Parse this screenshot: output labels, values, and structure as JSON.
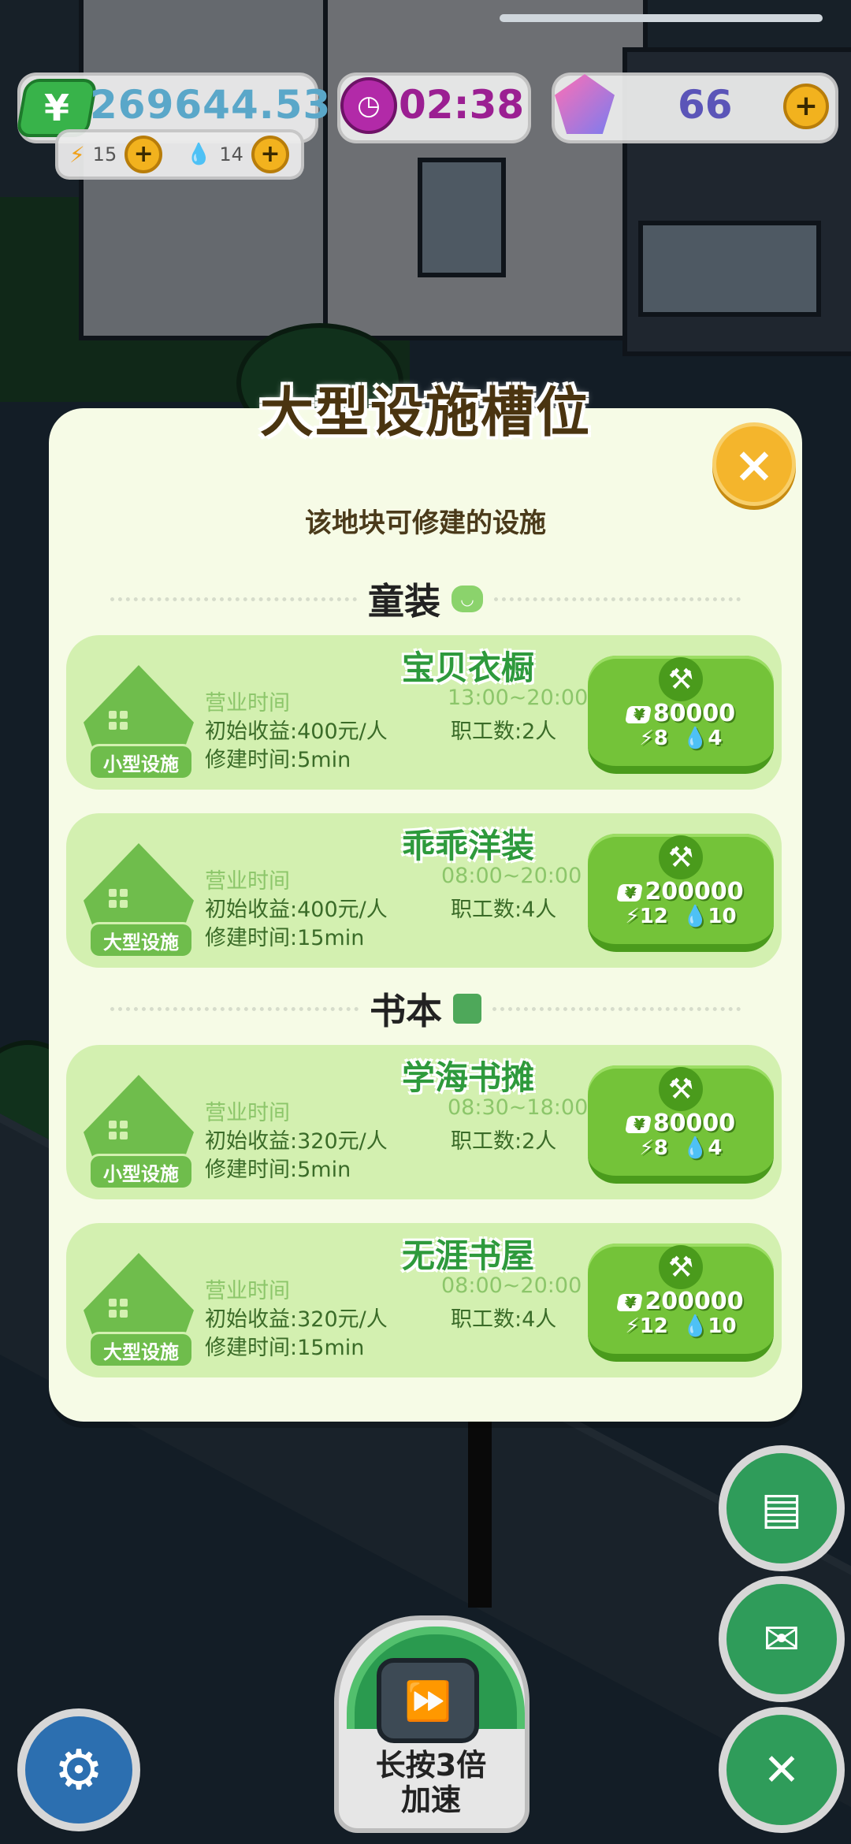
{
  "hud": {
    "currency_symbol": "¥",
    "money": "269644.53",
    "energy": "15",
    "water": "14",
    "timer": "02:38",
    "gems": "66",
    "plus": "+"
  },
  "modal": {
    "title": "大型设施槽位",
    "subtitle": "该地块可修建的设施",
    "close": "×",
    "sections": [
      {
        "label": "童装",
        "items": [
          {
            "name": "宝贝衣橱",
            "size_tag": "小型设施",
            "hours_label": "营业时间",
            "hours": "13:00~20:00",
            "income": "初始收益:400元/人",
            "staff": "职工数:2人",
            "build_time": "修建时间:5min",
            "cost_money": "80000",
            "cost_energy": "8",
            "cost_water": "4"
          },
          {
            "name": "乖乖洋装",
            "size_tag": "大型设施",
            "hours_label": "营业时间",
            "hours": "08:00~20:00",
            "income": "初始收益:400元/人",
            "staff": "职工数:4人",
            "build_time": "修建时间:15min",
            "cost_money": "200000",
            "cost_energy": "12",
            "cost_water": "10"
          }
        ]
      },
      {
        "label": "书本",
        "items": [
          {
            "name": "学海书摊",
            "size_tag": "小型设施",
            "hours_label": "营业时间",
            "hours": "08:30~18:00",
            "income": "初始收益:320元/人",
            "staff": "职工数:2人",
            "build_time": "修建时间:5min",
            "cost_money": "80000",
            "cost_energy": "8",
            "cost_water": "4"
          },
          {
            "name": "无涯书屋",
            "size_tag": "大型设施",
            "hours_label": "营业时间",
            "hours": "08:00~20:00",
            "income": "初始收益:320元/人",
            "staff": "职工数:4人",
            "build_time": "修建时间:15min",
            "cost_money": "200000",
            "cost_energy": "12",
            "cost_water": "10"
          }
        ]
      }
    ]
  },
  "speed_button": {
    "line1": "长按3倍",
    "line2": "加速"
  },
  "icons": {
    "currency": "yen-icon",
    "clock": "clock-icon",
    "gem": "gem-icon",
    "energy": "bolt-icon",
    "water": "drop-icon",
    "build": "hammer-icon",
    "settings": "gear-icon"
  },
  "colors": {
    "card_bg": "#d3f0b0",
    "button_green": "#74c339",
    "close_orange": "#f4b52c"
  }
}
